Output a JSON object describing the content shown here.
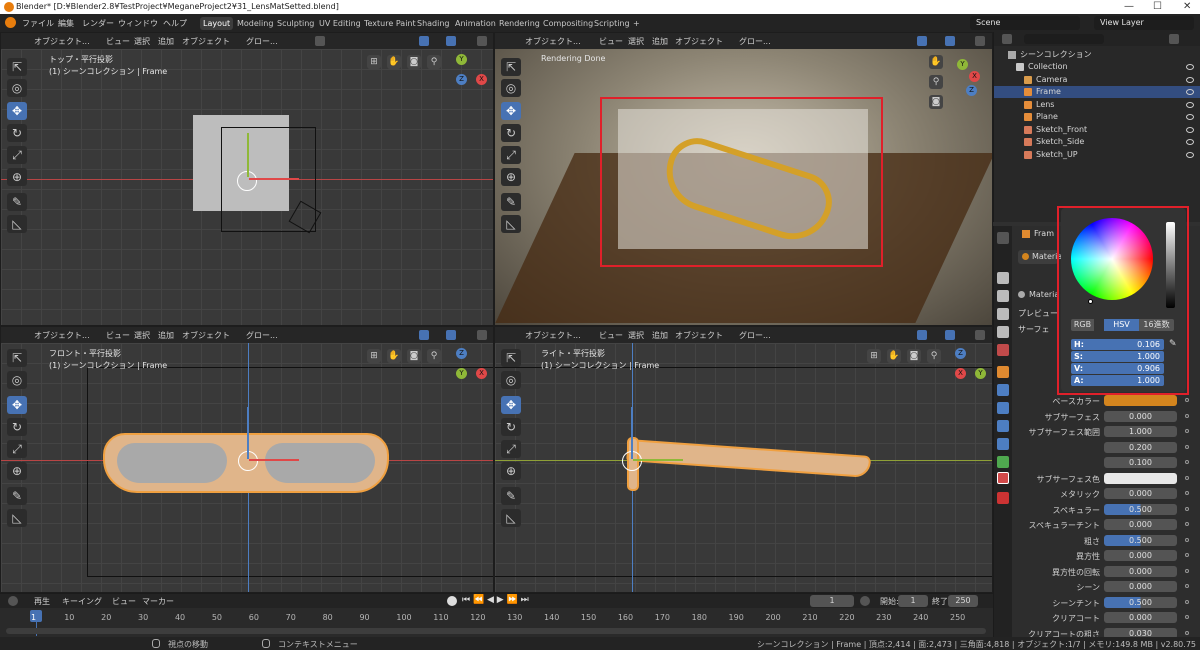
{
  "window": {
    "title": "Blender* [D:¥Blender2.8¥TestProject¥MeganeProject2¥31_LensMatSetted.blend]",
    "minimize": "—",
    "maximize": "☐",
    "close": "✕"
  },
  "menu": [
    "ファイル",
    "編集",
    "レンダー",
    "ウィンドウ",
    "ヘルプ"
  ],
  "workspaces": [
    "Layout",
    "Modeling",
    "Sculpting",
    "UV Editing",
    "Texture Paint",
    "Shading",
    "Animation",
    "Rendering",
    "Compositing",
    "Scripting",
    "+"
  ],
  "scene": "Scene",
  "view_layer": "View Layer",
  "vp_header": {
    "mode": "オブジェクト...",
    "view": "ビュー",
    "select": "選択",
    "add": "追加",
    "object": "オブジェクト",
    "global": "グロー..."
  },
  "viewports": {
    "top": {
      "title": "トップ・平行投影",
      "subtitle": "(1) シーンコレクション | Frame"
    },
    "render": {
      "status": "Rendering Done"
    },
    "front": {
      "title": "フロント・平行投影",
      "subtitle": "(1) シーンコレクション | Frame"
    },
    "right": {
      "title": "ライト・平行投影",
      "subtitle": "(1) シーンコレクション | Frame"
    }
  },
  "gizmo": {
    "x": "X",
    "y": "Y",
    "z": "Z"
  },
  "tools": [
    "⇱",
    "◎",
    "✥",
    "↻",
    "⤢",
    "⊕",
    "✎",
    "◺"
  ],
  "outliner": {
    "root": "シーンコレクション",
    "items": [
      {
        "name": "Collection",
        "icon": "collection-icon",
        "color": "#c9c9c9"
      },
      {
        "name": "Camera",
        "icon": "camera-icon",
        "color": "#d99b4b"
      },
      {
        "name": "Frame",
        "icon": "mesh-icon",
        "color": "#e58d3a",
        "selected": true
      },
      {
        "name": "Lens",
        "icon": "mesh-icon",
        "color": "#e58d3a"
      },
      {
        "name": "Plane",
        "icon": "mesh-icon",
        "color": "#e58d3a"
      },
      {
        "name": "Sketch_Front",
        "icon": "image-empty-icon",
        "color": "#d77a5a"
      },
      {
        "name": "Sketch_Side",
        "icon": "image-empty-icon",
        "color": "#d77a5a"
      },
      {
        "name": "Sketch_UP",
        "icon": "image-empty-icon",
        "color": "#d77a5a"
      }
    ]
  },
  "props": {
    "object_name": "Fram",
    "material_slot": "Materia",
    "material_name": "Materia",
    "preview": "プレビュー",
    "surface": "サーフェ",
    "rows": [
      {
        "label": "ベースカラー",
        "value": "",
        "kind": "color",
        "color": "#d4851e"
      },
      {
        "label": "サブサーフェス",
        "value": "0.000"
      },
      {
        "label": "サブサーフェス範囲",
        "value": "1.000"
      },
      {
        "label": "",
        "value": "0.200"
      },
      {
        "label": "",
        "value": "0.100"
      },
      {
        "label": "サブサーフェス色",
        "value": "",
        "kind": "color",
        "color": "#e8e8e8"
      },
      {
        "label": "メタリック",
        "value": "0.000"
      },
      {
        "label": "スペキュラー",
        "value": "0.500",
        "kind": "slider",
        "fraction": 0.5
      },
      {
        "label": "スペキュラーチント",
        "value": "0.000"
      },
      {
        "label": "粗さ",
        "value": "0.500",
        "kind": "slider",
        "fraction": 0.5
      },
      {
        "label": "異方性",
        "value": "0.000"
      },
      {
        "label": "異方性の回転",
        "value": "0.000"
      },
      {
        "label": "シーン",
        "value": "0.000"
      },
      {
        "label": "シーンチント",
        "value": "0.500",
        "kind": "slider",
        "fraction": 0.5
      },
      {
        "label": "クリアコート",
        "value": "0.000"
      },
      {
        "label": "クリアコートの粗さ",
        "value": "0.030"
      }
    ]
  },
  "color_picker": {
    "modes": [
      "RGB",
      "HSV",
      "16進数"
    ],
    "active_mode": "HSV",
    "fields": [
      {
        "key": "H:",
        "value": "0.106"
      },
      {
        "key": "S:",
        "value": "1.000"
      },
      {
        "key": "V:",
        "value": "0.906"
      },
      {
        "key": "A:",
        "value": "1.000"
      }
    ]
  },
  "timeline": {
    "menu": [
      "再生",
      "キーイング",
      "ビュー",
      "マーカー"
    ],
    "current_frame": "1",
    "start_label": "開始:",
    "start": "1",
    "end_label": "終了:",
    "end": "250",
    "ticks": [
      "1",
      "10",
      "20",
      "30",
      "40",
      "50",
      "60",
      "70",
      "80",
      "90",
      "100",
      "110",
      "120",
      "130",
      "140",
      "150",
      "160",
      "170",
      "180",
      "190",
      "200",
      "210",
      "220",
      "230",
      "240",
      "250"
    ]
  },
  "status": {
    "left": "視点の移動",
    "middle": "コンテキストメニュー",
    "right": "シーンコレクション | Frame | 頂点:2,414 | 面:2,473 | 三角面:4,818 | オブジェクト:1/7 | メモリ:149.8 MB | v2.80.75"
  }
}
